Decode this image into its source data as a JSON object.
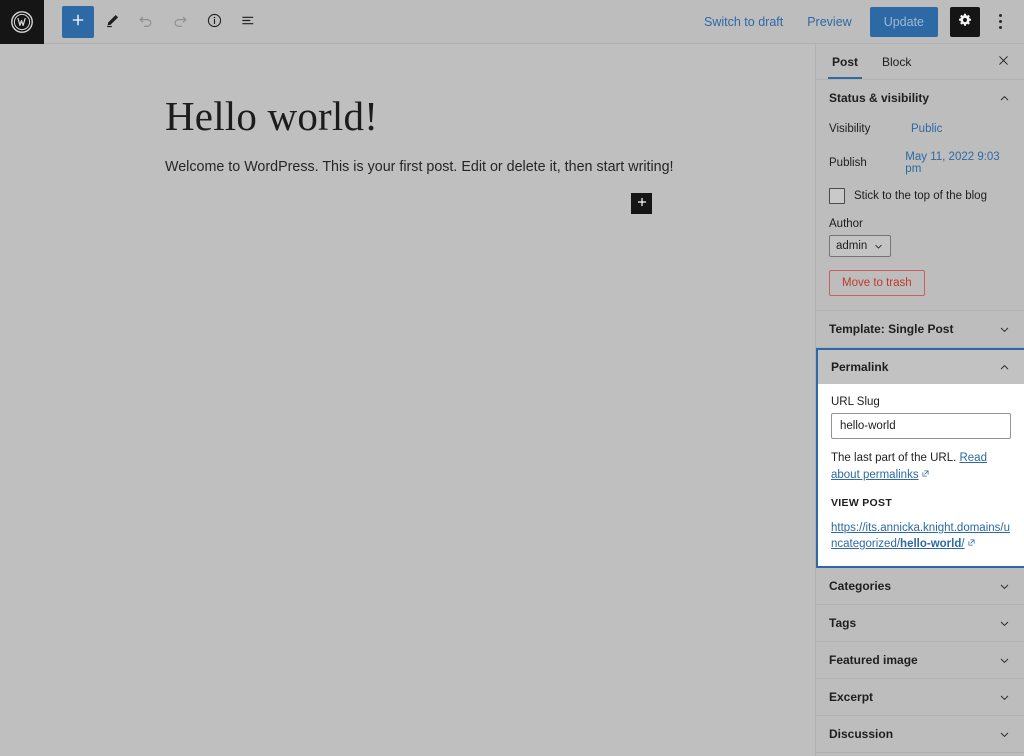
{
  "app": {
    "logo_icon": "wordpress-logo-icon"
  },
  "toolbar": {
    "add_block_icon": "plus-icon",
    "tools_icon": "pencil-icon",
    "undo_icon": "undo-arrow-icon",
    "redo_icon": "redo-arrow-icon",
    "details_icon": "info-circle-icon",
    "list_view_icon": "list-view-icon",
    "switch_to_draft": "Switch to draft",
    "preview": "Preview",
    "update": "Update",
    "settings_icon": "gear-icon",
    "options_icon": "more-vertical-dots-icon"
  },
  "editor": {
    "title": "Hello world!",
    "paragraph": "Welcome to WordPress. This is your first post. Edit or delete it, then start writing!",
    "block_inserter_icon": "plus-icon"
  },
  "sidebar": {
    "tabs": [
      {
        "label": "Post",
        "active": true
      },
      {
        "label": "Block",
        "active": false
      }
    ],
    "close_icon": "close-x-icon",
    "status_visibility": {
      "title": "Status & visibility",
      "expanded": true,
      "collapse_icon": "chevron-up-icon",
      "visibility_label": "Visibility",
      "visibility_value": "Public",
      "publish_label": "Publish",
      "publish_value": "May 11, 2022 9:03 pm",
      "sticky_label": "Stick to the top of the blog",
      "sticky_checked": false,
      "author_label": "Author",
      "author_value": "admin",
      "author_dropdown_icon": "chevron-down-icon",
      "move_to_trash": "Move to trash"
    },
    "template": {
      "title": "Template: Single Post",
      "expanded": false,
      "expand_icon": "chevron-down-icon"
    },
    "permalink": {
      "title": "Permalink",
      "expanded": true,
      "focused": true,
      "collapse_icon": "chevron-up-icon",
      "slug_label": "URL Slug",
      "slug_value": "hello-world",
      "help_prefix": "The last part of the URL. ",
      "help_link": "Read about permalinks",
      "external_icon": "external-link-icon",
      "view_post_label": "VIEW POST",
      "post_url_prefix": "https://its.annicka.knight.domains/uncategorized/",
      "post_url_slug": "hello-world",
      "post_url_suffix": "/"
    },
    "panels": [
      {
        "title": "Categories",
        "expand_icon": "chevron-down-icon"
      },
      {
        "title": "Tags",
        "expand_icon": "chevron-down-icon"
      },
      {
        "title": "Featured image",
        "expand_icon": "chevron-down-icon"
      },
      {
        "title": "Excerpt",
        "expand_icon": "chevron-down-icon"
      },
      {
        "title": "Discussion",
        "expand_icon": "chevron-down-icon"
      }
    ]
  },
  "colors": {
    "accent": "#2d69a4",
    "canvas_bg": "#bfbfbf",
    "sidebar_bg": "#bdbdbd",
    "danger": "#c0392b",
    "dark": "#151515"
  }
}
